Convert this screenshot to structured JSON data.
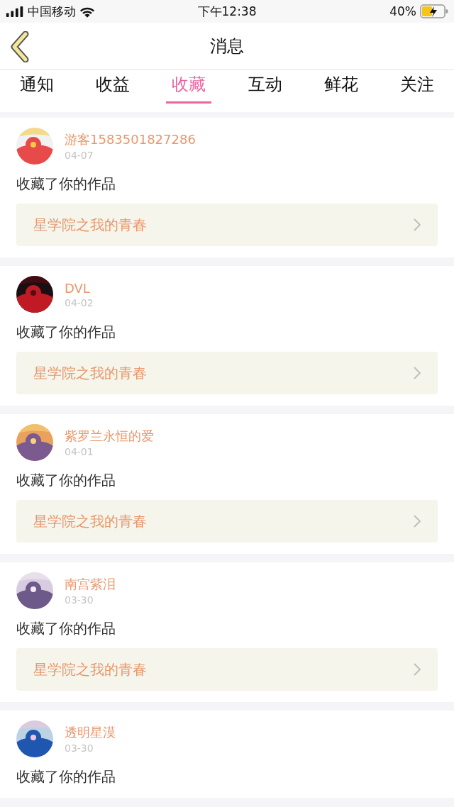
{
  "status_bar": {
    "carrier": "中国移动",
    "time": "下午12:38",
    "battery": "40%"
  },
  "nav": {
    "title": "消息"
  },
  "tabs": [
    {
      "label": "通知",
      "selected": false
    },
    {
      "label": "收益",
      "selected": false
    },
    {
      "label": "收藏",
      "selected": true
    },
    {
      "label": "互动",
      "selected": false
    },
    {
      "label": "鲜花",
      "selected": false
    },
    {
      "label": "关注",
      "selected": false
    }
  ],
  "messages": [
    {
      "user": "游客1583501827286",
      "date": "04-07",
      "action": "收藏了你的作品",
      "work": "星学院之我的青春"
    },
    {
      "user": "DVL",
      "date": "04-02",
      "action": "收藏了你的作品",
      "work": "星学院之我的青春"
    },
    {
      "user": "紫罗兰永恒的爱",
      "date": "04-01",
      "action": "收藏了你的作品",
      "work": "星学院之我的青春"
    },
    {
      "user": "南宫紫泪",
      "date": "03-30",
      "action": "收藏了你的作品",
      "work": "星学院之我的青春"
    },
    {
      "user": "透明星漠",
      "date": "03-30",
      "action": "收藏了你的作品"
    }
  ]
}
